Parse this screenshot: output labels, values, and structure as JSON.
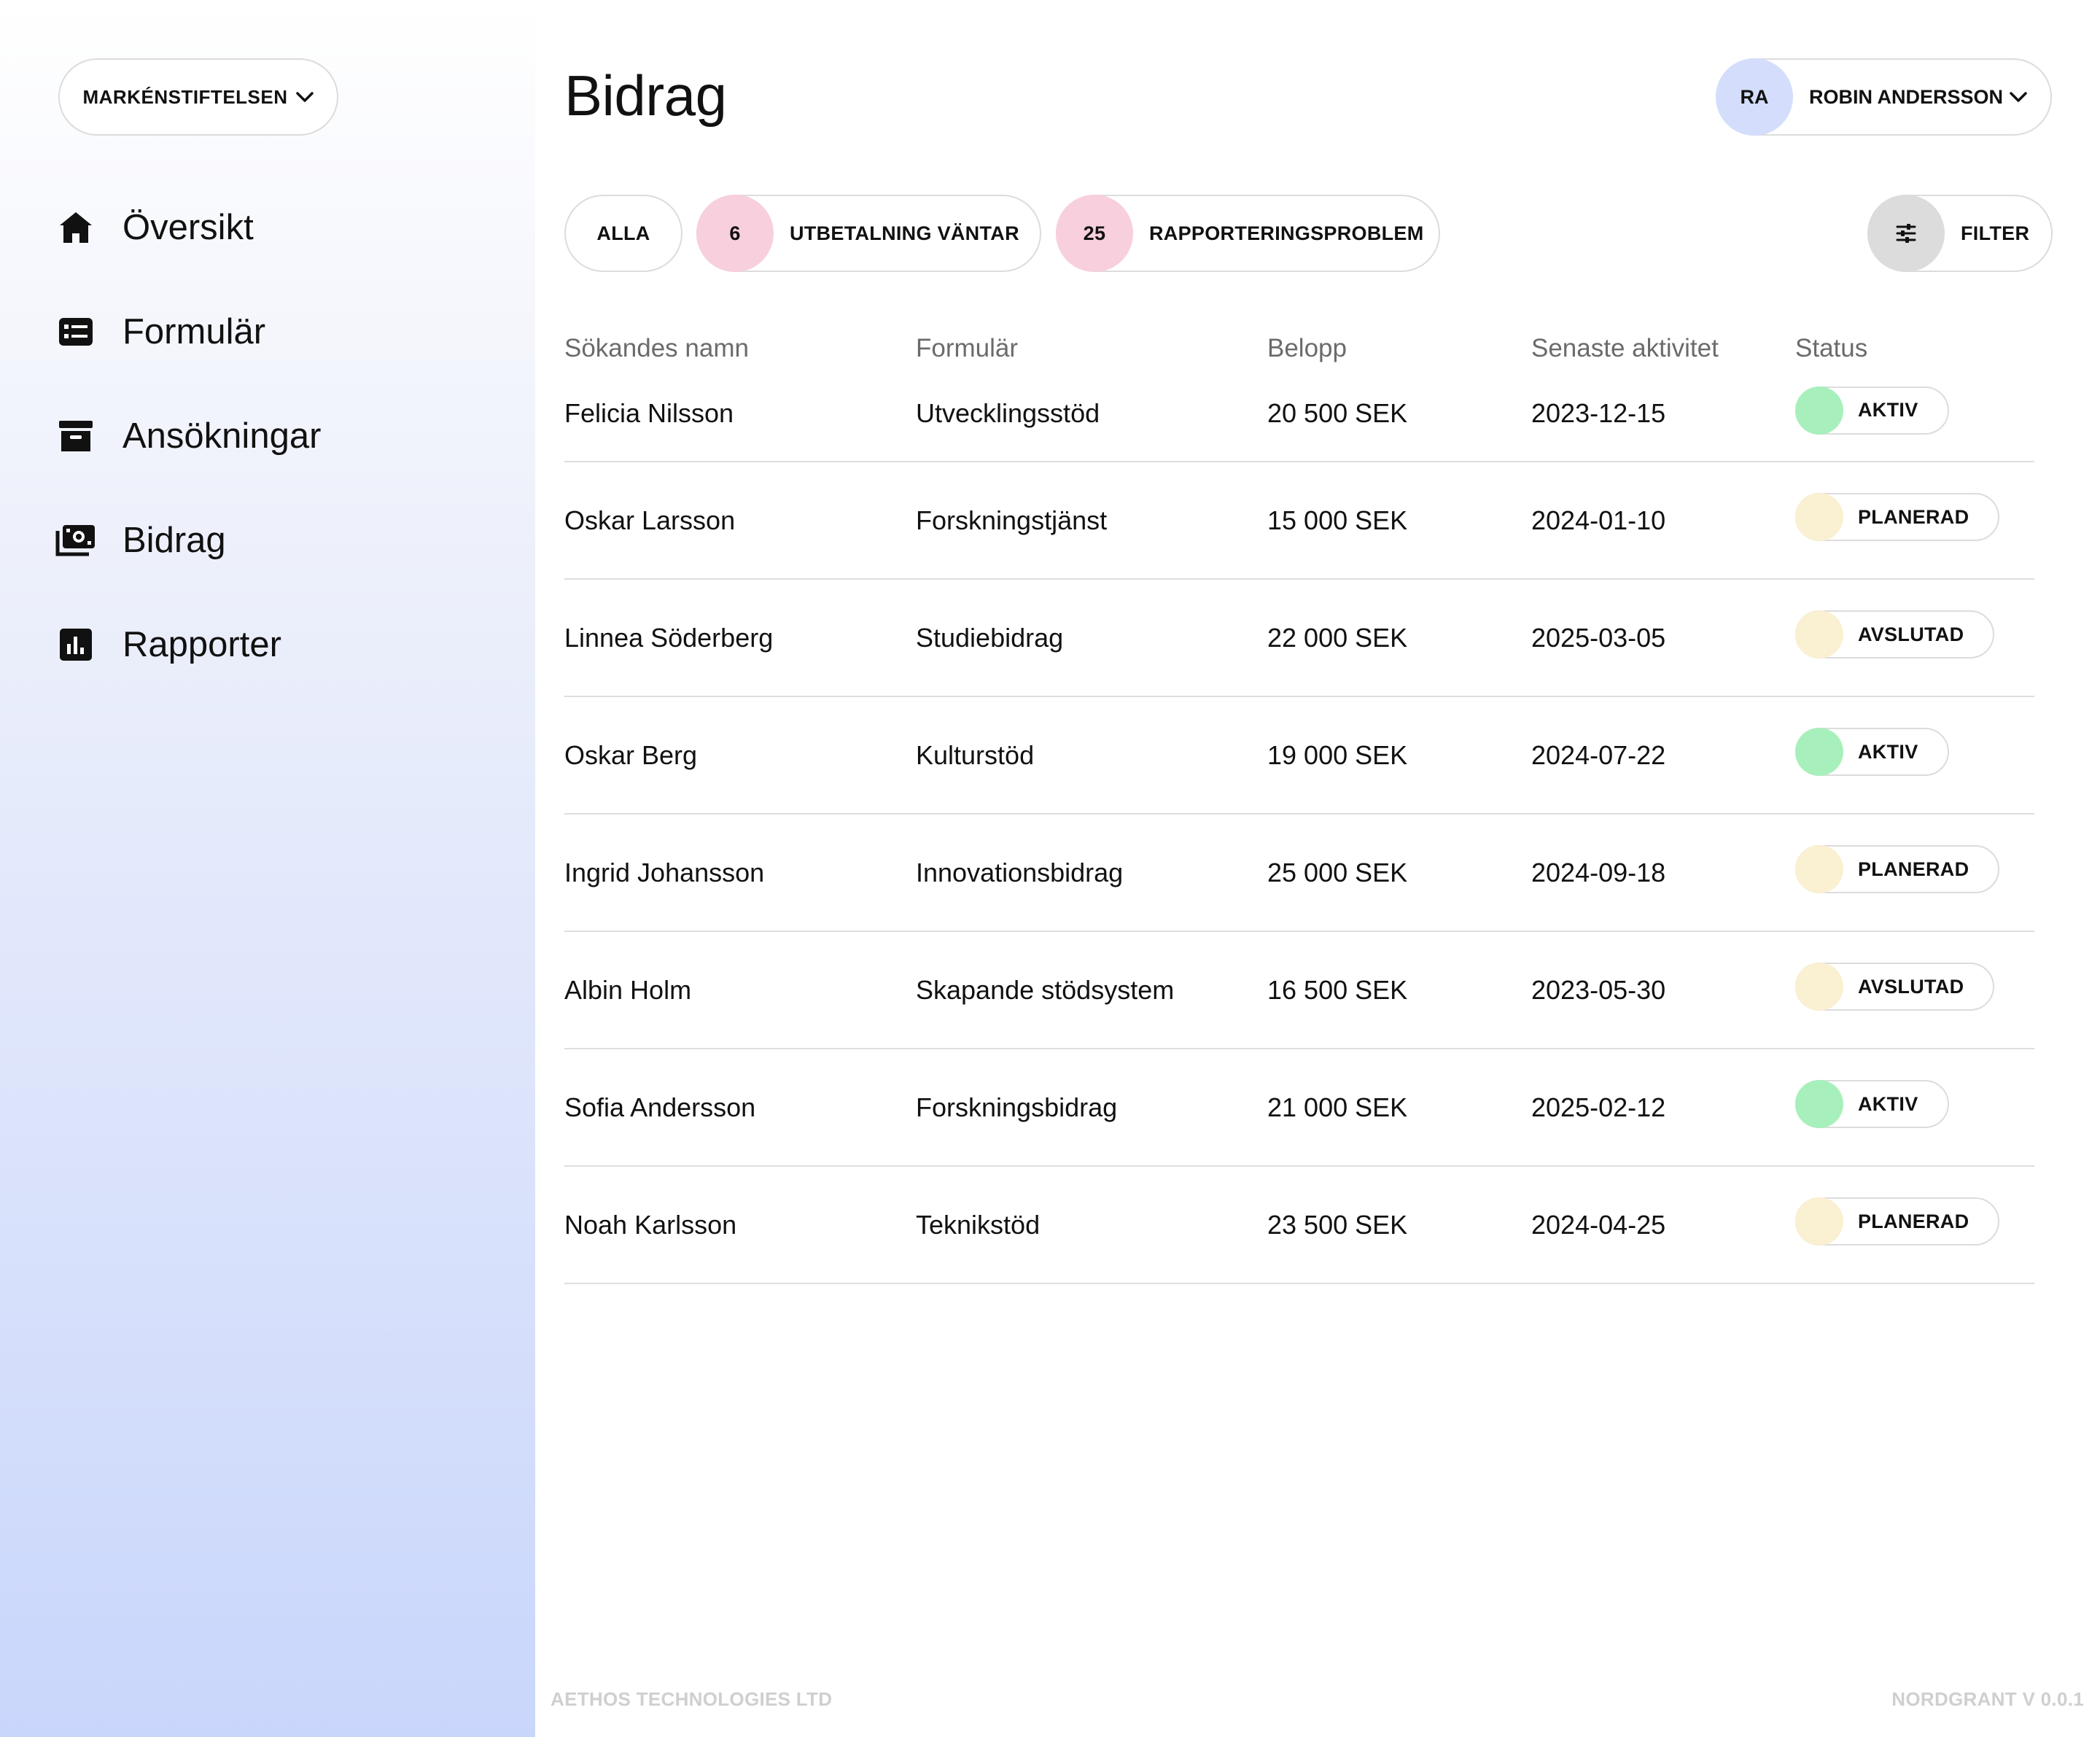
{
  "org": {
    "name": "MARKÉNSTIFTELSEN"
  },
  "nav": [
    {
      "label": "Översikt",
      "icon": "home-icon"
    },
    {
      "label": "Formulär",
      "icon": "form-icon"
    },
    {
      "label": "Ansökningar",
      "icon": "archive-icon"
    },
    {
      "label": "Bidrag",
      "icon": "money-icon"
    },
    {
      "label": "Rapporter",
      "icon": "chart-icon"
    }
  ],
  "page": {
    "title": "Bidrag"
  },
  "user": {
    "initials": "RA",
    "name": "ROBIN ANDERSSON"
  },
  "filters": {
    "all_label": "ALLA",
    "payment_count": "6",
    "payment_label": "UTBETALNING VÄNTAR",
    "report_count": "25",
    "report_label": "RAPPORTERINGSPROBLEM",
    "filter_label": "FILTER"
  },
  "table": {
    "headers": [
      "Sökandes namn",
      "Formulär",
      "Belopp",
      "Senaste aktivitet",
      "Status"
    ],
    "rows": [
      {
        "name": "Felicia Nilsson",
        "form": "Utvecklingsstöd",
        "amount": "20 500 SEK",
        "date": "2023-12-15",
        "status": "AKTIV"
      },
      {
        "name": "Oskar Larsson",
        "form": "Forskningstjänst",
        "amount": "15 000 SEK",
        "date": "2024-01-10",
        "status": "PLANERAD"
      },
      {
        "name": "Linnea Söderberg",
        "form": "Studiebidrag",
        "amount": "22 000 SEK",
        "date": "2025-03-05",
        "status": "AVSLUTAD"
      },
      {
        "name": "Oskar Berg",
        "form": "Kulturstöd",
        "amount": "19 000 SEK",
        "date": "2024-07-22",
        "status": "AKTIV"
      },
      {
        "name": "Ingrid Johansson",
        "form": "Innovationsbidrag",
        "amount": "25 000 SEK",
        "date": "2024-09-18",
        "status": "PLANERAD"
      },
      {
        "name": "Albin Holm",
        "form": "Skapande stödsystem",
        "amount": "16 500 SEK",
        "date": "2023-05-30",
        "status": "AVSLUTAD"
      },
      {
        "name": "Sofia Andersson",
        "form": "Forskningsbidrag",
        "amount": "21 000 SEK",
        "date": "2025-02-12",
        "status": "AKTIV"
      },
      {
        "name": "Noah Karlsson",
        "form": "Teknikstöd",
        "amount": "23 500 SEK",
        "date": "2024-04-25",
        "status": "PLANERAD"
      }
    ]
  },
  "status_colors": {
    "AKTIV": "#a7f0bc",
    "PLANERAD": "#faf0d2",
    "AVSLUTAD": "#faf0d2"
  },
  "footer": {
    "left": "AETHOS TECHNOLOGIES LTD",
    "right": "NORDGRANT V 0.0.1"
  }
}
